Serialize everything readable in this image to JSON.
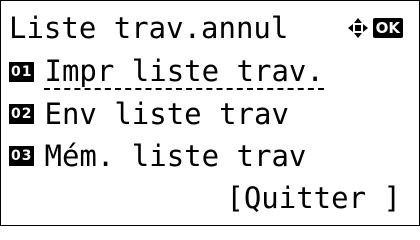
{
  "screen": {
    "title": "Liste trav.annul",
    "ok_label": "OK",
    "nav_icon": "four-way-arrow-icon"
  },
  "menu": {
    "items": [
      {
        "number": "01",
        "label": "Impr liste trav.",
        "selected": true
      },
      {
        "number": "02",
        "label": "Env liste trav",
        "selected": false
      },
      {
        "number": "03",
        "label": "Mém. liste trav",
        "selected": false
      }
    ]
  },
  "softkey": {
    "open": "[",
    "label": "Quitter",
    "close": "]"
  }
}
